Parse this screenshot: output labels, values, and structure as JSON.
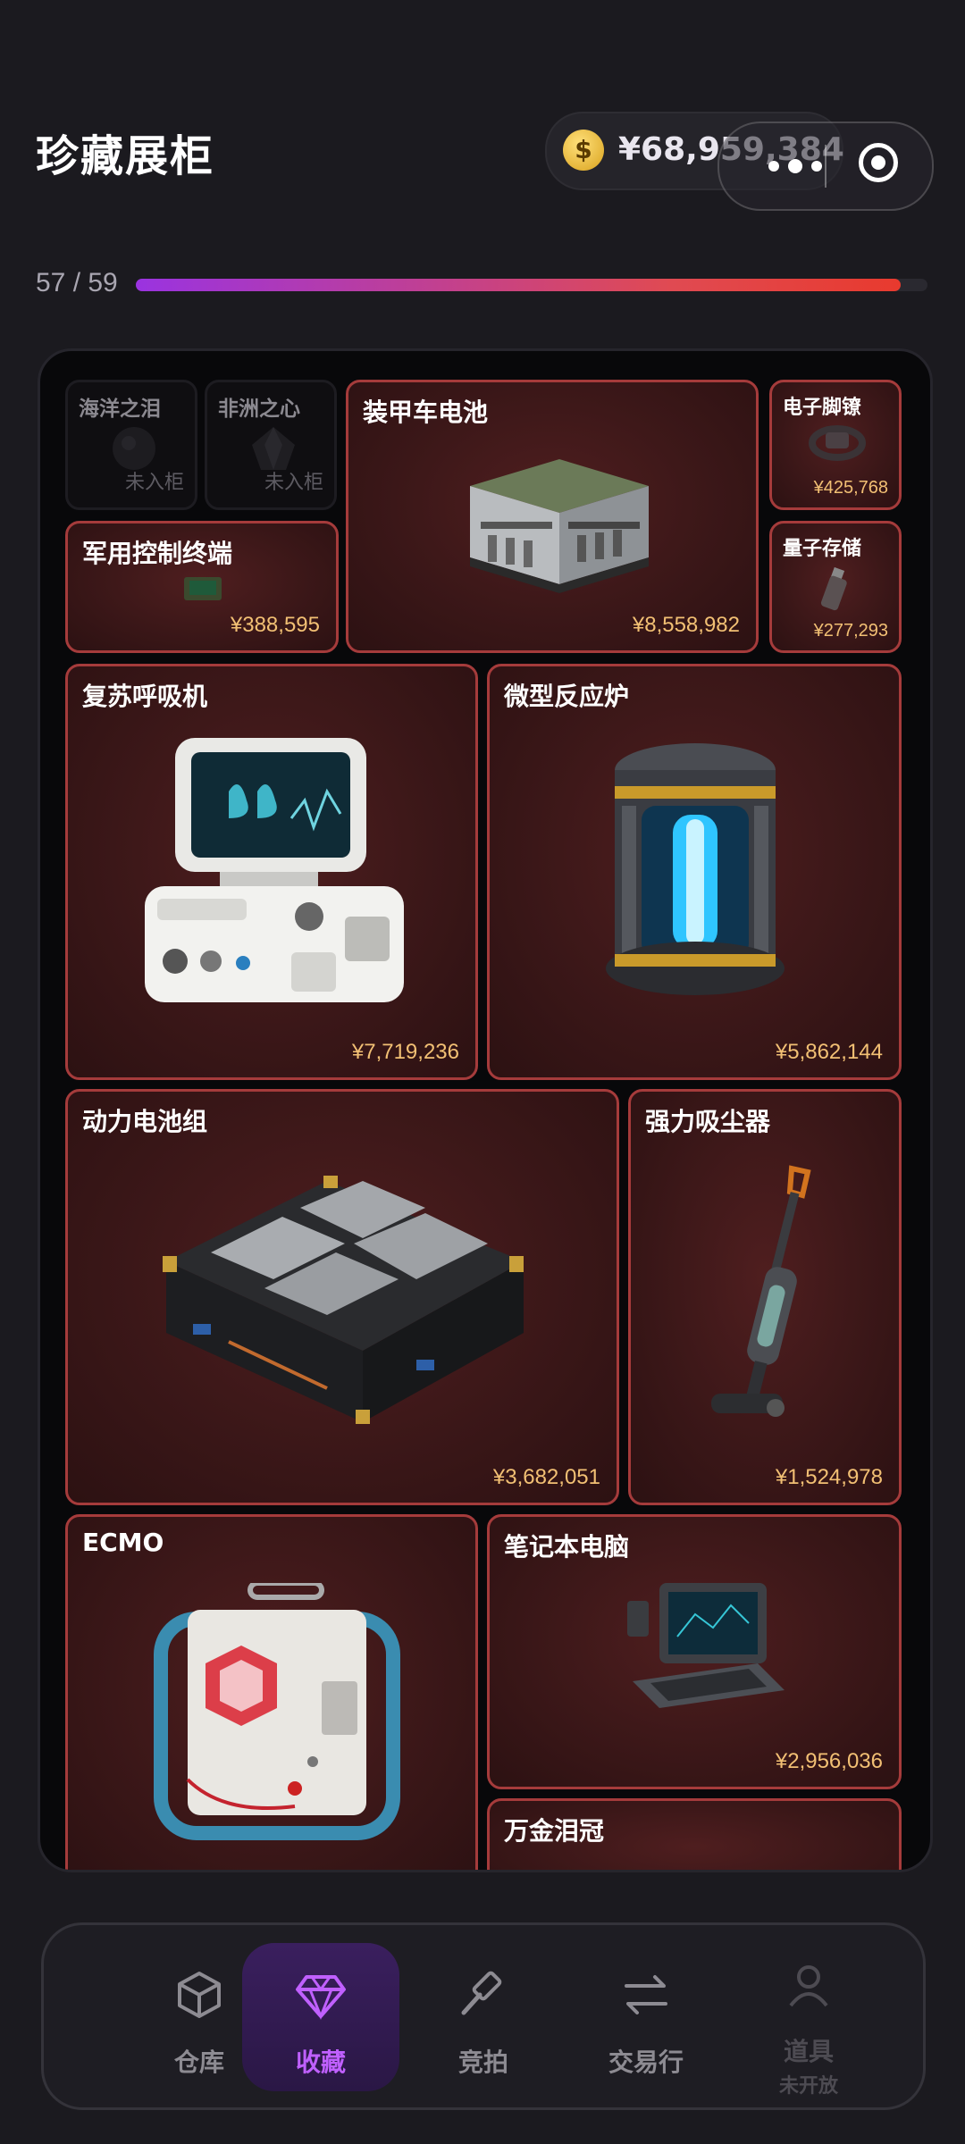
{
  "header": {
    "title": "珍藏展柜",
    "balance": "¥68,959,384"
  },
  "progress": {
    "label": "57 / 59",
    "collected": 57,
    "total": 59
  },
  "showcase": {
    "items": [
      {
        "name": "海洋之泪",
        "status": "未入柜"
      },
      {
        "name": "非洲之心",
        "status": "未入柜"
      },
      {
        "name": "装甲车电池",
        "price": "¥8,558,982"
      },
      {
        "name": "电子脚镣",
        "price": "¥425,768"
      },
      {
        "name": "军用控制终端",
        "price": "¥388,595"
      },
      {
        "name": "量子存储",
        "price": "¥277,293"
      },
      {
        "name": "复苏呼吸机",
        "price": "¥7,719,236"
      },
      {
        "name": "微型反应炉",
        "price": "¥5,862,144"
      },
      {
        "name": "动力电池组",
        "price": "¥3,682,051"
      },
      {
        "name": "强力吸尘器",
        "price": "¥1,524,978"
      },
      {
        "name": "ECMO"
      },
      {
        "name": "笔记本电脑",
        "price": "¥2,956,036"
      },
      {
        "name": "万金泪冠"
      }
    ]
  },
  "tabbar": {
    "tabs": [
      {
        "label": "仓库",
        "icon": "box-icon"
      },
      {
        "label": "收藏",
        "icon": "diamond-icon",
        "active": true
      },
      {
        "label": "竞拍",
        "icon": "gavel-icon"
      },
      {
        "label": "交易行",
        "icon": "swap-arrows-icon"
      },
      {
        "label": "道具",
        "sub": "未开放",
        "icon": "person-icon",
        "disabled": true
      }
    ]
  },
  "colors": {
    "accent": "#c060ff",
    "price": "#f2c074",
    "card_border": "#a53b3b"
  }
}
